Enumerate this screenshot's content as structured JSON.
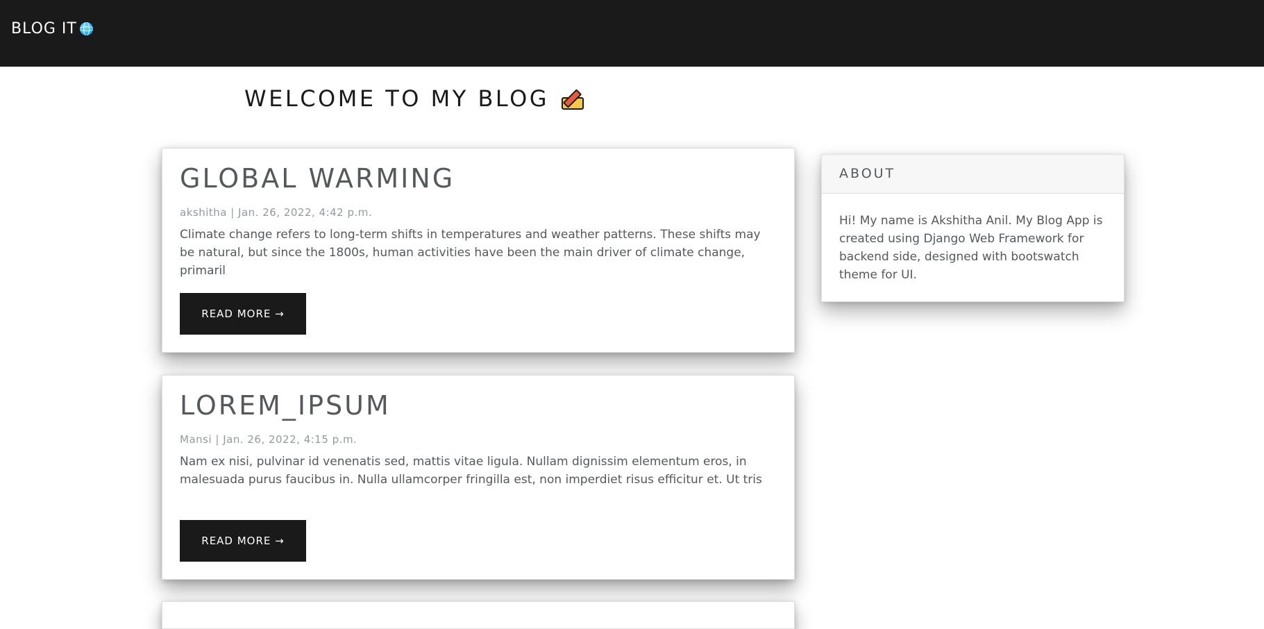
{
  "navbar": {
    "brand": "BLOG IT",
    "brand_icon": "globe-icon"
  },
  "header": {
    "title": "WELCOME TO MY BLOG",
    "title_icon": "writing-hand-icon"
  },
  "posts": [
    {
      "title": "GLOBAL WARMING",
      "meta": "akshitha | Jan. 26, 2022, 4:42 p.m.",
      "excerpt": "Climate change refers to long-term shifts in temperatures and weather patterns. These shifts may be natural, but since the 1800s, human activities have been the main driver of climate change, primaril",
      "button_label": "READ MORE →"
    },
    {
      "title": "LOREM_IPSUM",
      "meta": "Mansi | Jan. 26, 2022, 4:15 p.m.",
      "excerpt": "Nam ex nisi, pulvinar id venenatis sed, mattis vitae ligula. Nullam dignissim elementum eros, in malesuada purus faucibus in. Nulla ullamcorper fringilla est, non imperdiet risus efficitur et. Ut tris",
      "button_label": "READ MORE →"
    }
  ],
  "sidebar": {
    "about_title": "ABOUT",
    "about_text": "Hi! My name is Akshitha Anil. My Blog App is created using Django Web Framework for backend side, designed with bootswatch theme for UI."
  },
  "colors": {
    "navbar_bg": "#1a1a1a",
    "button_bg": "#1a1a1a",
    "text": "#55595c",
    "meta_text": "#919aa1"
  }
}
